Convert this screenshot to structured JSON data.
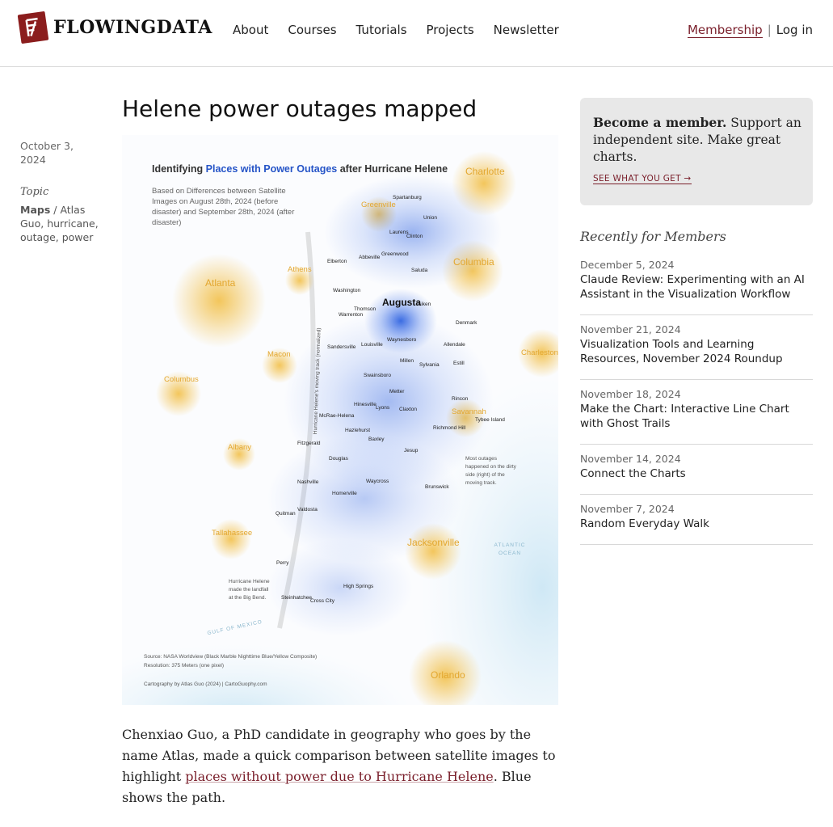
{
  "site": {
    "name": "FLOWINGDATA"
  },
  "nav": [
    {
      "label": "About"
    },
    {
      "label": "Courses"
    },
    {
      "label": "Tutorials"
    },
    {
      "label": "Projects"
    },
    {
      "label": "Newsletter"
    }
  ],
  "account": {
    "membership": "Membership",
    "separator": "|",
    "login": "Log in"
  },
  "post": {
    "title": "Helene power outages mapped",
    "date_line1": "October 3,",
    "date_line2": "2024",
    "topic_label": "Topic",
    "topic_primary": "Maps",
    "topic_rest": "Atlas Guo, hurricane, outage, power",
    "topic_sep": "/",
    "body_before": "Chenxiao Guo, a PhD candidate in geography who goes by the name Atlas, made a quick comparison between satellite images to highlight ",
    "body_link": "places without power due to Hurricane Helene",
    "body_after": ". Blue shows the path."
  },
  "map": {
    "title_pre": "Identifying ",
    "title_hl": "Places with Power Outages",
    "title_post": " after Hurricane Helene",
    "subtitle": "Based on Differences between Satellite Images on August 28th, 2024 (before disaster) and September 28th, 2024 (after disaster)",
    "track_label": "Hurricane Helene's moving track (normalized)",
    "note_outages": "Most outages happened on the dirty side (right) of the moving track.",
    "note_landfall": "Hurricane Helene made the landfall at the Big Bend.",
    "gulf": "GULF OF MEXICO",
    "ocean": "ATLANTIC OCEAN",
    "source": "Source: NASA Worldview (Black Marble Nighttime Blue/Yellow Composite)",
    "resolution": "Resolution: 375 Meters (one pixel)",
    "credit": "Cartography by Atlas Guo (2024)   |   CartoGuophy.com",
    "colors": {
      "outage": "#2f63e0",
      "city_light": "#e3a72f",
      "water": "#d8eef8"
    },
    "big_cities": [
      "Charlotte",
      "Greenville",
      "Columbia",
      "Atlanta",
      "Athens",
      "Macon",
      "Charleston",
      "Columbus",
      "Savannah",
      "Albany",
      "Tallahassee",
      "Jacksonville",
      "Orlando"
    ],
    "small_cities": [
      "Spartanburg",
      "Union",
      "Laurens",
      "Clinton",
      "Greenwood",
      "Abbeville",
      "Elberton",
      "Saluda",
      "Washington",
      "Thomson",
      "Aiken",
      "Warrenton",
      "Denmark",
      "Sandersville",
      "Louisville",
      "Waynesboro",
      "Allendale",
      "Millen",
      "Sylvania",
      "Estill",
      "Swainsboro",
      "Metter",
      "Hinesville",
      "Lyons",
      "Claxton",
      "Rincon",
      "Tybee Island",
      "McRae-Helena",
      "Richmond Hill",
      "Hazlehurst",
      "Baxley",
      "Fitzgerald",
      "Jesup",
      "Douglas",
      "Waycross",
      "Nashville",
      "Brunswick",
      "Homerville",
      "Quitman",
      "Valdosta",
      "Perry",
      "High Springs",
      "Steinhatchee",
      "Cross City"
    ],
    "augusta": "Augusta"
  },
  "sidebar": {
    "member_bold": "Become a member.",
    "member_text": " Support an independent site. Make great charts.",
    "member_cta": "SEE WHAT YOU GET →",
    "recent_title": "Recently for Members",
    "recent": [
      {
        "date": "December 5, 2024",
        "title": "Claude Review: Experimenting with an AI Assistant in the Visualization Workflow"
      },
      {
        "date": "November 21, 2024",
        "title": "Visualization Tools and Learning Resources, November 2024 Roundup"
      },
      {
        "date": "November 18, 2024",
        "title": "Make the Chart: Interactive Line Chart with Ghost Trails"
      },
      {
        "date": "November 14, 2024",
        "title": "Connect the Charts"
      },
      {
        "date": "November 7, 2024",
        "title": "Random Everyday Walk"
      }
    ]
  }
}
